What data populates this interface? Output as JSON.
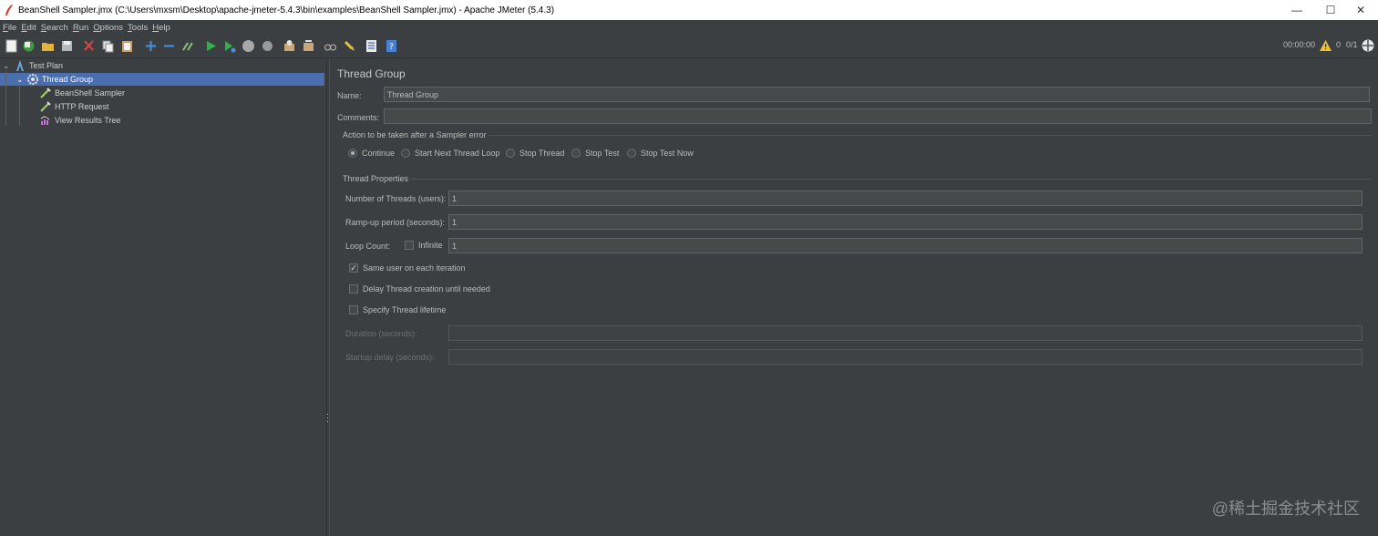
{
  "window": {
    "title": "BeanShell Sampler.jmx (C:\\Users\\mxsm\\Desktop\\apache-jmeter-5.4.3\\bin\\examples\\BeanShell Sampler.jmx) - Apache JMeter (5.4.3)",
    "minimize": "—",
    "maximize": "☐",
    "close": "✕"
  },
  "menu": [
    {
      "u": "F",
      "rest": "ile"
    },
    {
      "u": "E",
      "rest": "dit"
    },
    {
      "u": "S",
      "rest": "earch"
    },
    {
      "u": "R",
      "rest": "un"
    },
    {
      "u": "O",
      "rest": "ptions"
    },
    {
      "u": "T",
      "rest": "ools"
    },
    {
      "u": "H",
      "rest": "elp"
    }
  ],
  "status": {
    "timer": "00:00:00",
    "warnings": "0",
    "threads": "0/1"
  },
  "tree": {
    "test_plan": "Test Plan",
    "thread_group": "Thread Group",
    "beanshell": "BeanShell Sampler",
    "http": "HTTP Request",
    "results": "View Results Tree"
  },
  "panel": {
    "title": "Thread Group",
    "name_label": "Name:",
    "name_value": "Thread Group",
    "comments_label": "Comments:",
    "comments_value": "",
    "error_section": "Action to be taken after a Sampler error",
    "actions": [
      "Continue",
      "Start Next Thread Loop",
      "Stop Thread",
      "Stop Test",
      "Stop Test Now"
    ],
    "selected_action": "Continue",
    "props_section": "Thread Properties",
    "threads_label": "Number of Threads (users):",
    "threads_value": "1",
    "rampup_label": "Ramp-up period (seconds):",
    "rampup_value": "1",
    "loop_label": "Loop Count:",
    "infinite_label": "Infinite",
    "infinite_checked": false,
    "loop_value": "1",
    "same_user_label": "Same user on each iteration",
    "same_user_checked": true,
    "delay_label": "Delay Thread creation until needed",
    "delay_checked": false,
    "lifetime_label": "Specify Thread lifetime",
    "lifetime_checked": false,
    "duration_label": "Duration (seconds):",
    "duration_value": "",
    "startup_label": "Startup delay (seconds):",
    "startup_value": ""
  },
  "watermark": "@稀土掘金技术社区"
}
